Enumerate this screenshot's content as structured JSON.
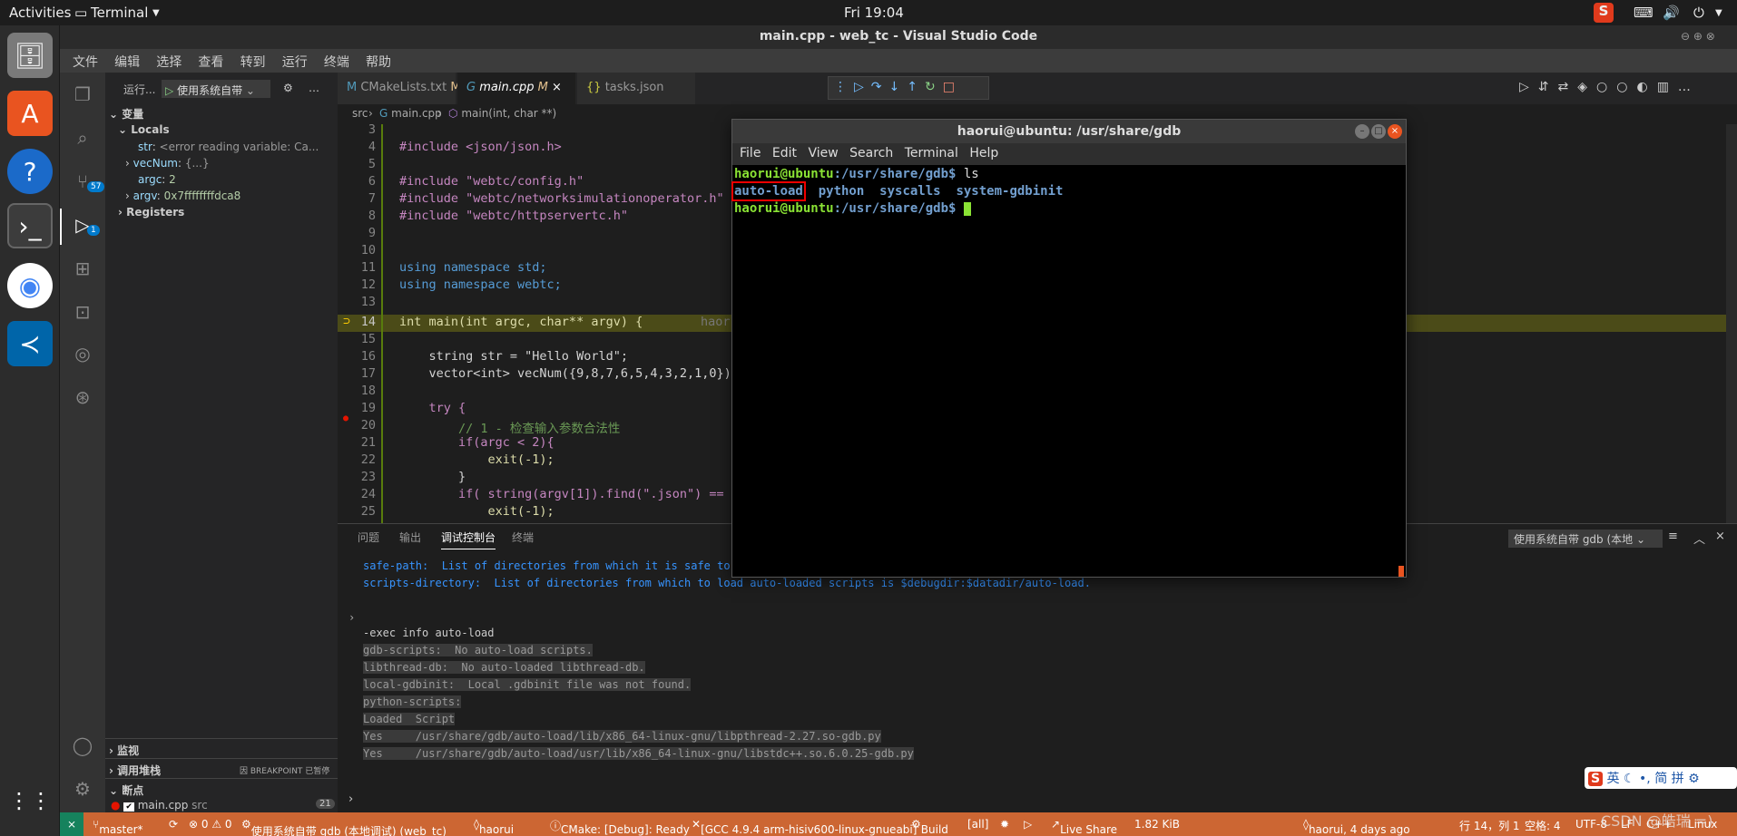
{
  "topbar": {
    "activities": "Activities",
    "app": "Terminal",
    "clock": "Fri 19:04"
  },
  "window": {
    "title": "main.cpp - web_tc - Visual Studio Code"
  },
  "menu": [
    "文件",
    "编辑",
    "选择",
    "查看",
    "转到",
    "运行",
    "终端",
    "帮助"
  ],
  "activity": {
    "source_badge": "57",
    "debug_badge": "1"
  },
  "sidebar": {
    "run_label": "运行...",
    "config": "使用系统自带",
    "variables": "变量",
    "locals": "Locals",
    "vars": [
      {
        "name": "str",
        "value": "<error reading variable: Ca..."
      },
      {
        "name": "vecNum",
        "value": "{...}"
      },
      {
        "name": "argc",
        "value": "2"
      },
      {
        "name": "argv",
        "value": "0x7ffffffffdca8"
      }
    ],
    "registers": "Registers",
    "watch": "监视",
    "callstack": "调用堆栈",
    "breakpoint_status": "因 BREAKPOINT 已暂停",
    "breakpoints": "断点",
    "bp_file": "main.cpp",
    "bp_dir": "src",
    "bp_line": "21"
  },
  "tabs": [
    {
      "label": "CMakeLists.txt",
      "mod": "M"
    },
    {
      "label": "main.cpp",
      "mod": "M"
    },
    {
      "label": "tasks.json",
      "mod": ""
    }
  ],
  "breadcrumb": {
    "folder": "src",
    "file": "main.cpp",
    "symbol": "main(int, char **)"
  },
  "code_lines": [
    "3",
    "4",
    "5",
    "6",
    "7",
    "8",
    "9",
    "10",
    "11",
    "12",
    "13",
    "14",
    "15",
    "16",
    "17",
    "18",
    "19",
    "20",
    "21",
    "22",
    "23",
    "24",
    "25"
  ],
  "code_text": {
    "l4": "#include <json/json.h>",
    "l6": "#include \"webtc/config.h\"",
    "l7": "#include \"webtc/networksimulationoperator.h\"",
    "l8": "#include \"webtc/httpservertc.h\"",
    "l11": "using namespace std;",
    "l12": "using namespace webtc;",
    "l14": "int main(int argc, char** argv) {",
    "l14_hint": "haor",
    "l16": "    string str = \"Hello World\";",
    "l17": "    vector<int> vecNum({9,8,7,6,5,4,3,2,1,0});",
    "l19": "    try {",
    "l20": "        // 1 - 检查输入参数合法性",
    "l21": "        if(argc < 2){",
    "l22": "            exit(-1);",
    "l23": "        }",
    "l24": "        if( string(argv[1]).find(\".json\") ==",
    "l25": "            exit(-1);"
  },
  "panel": {
    "tabs": [
      "问题",
      "输出",
      "调试控制台",
      "终端"
    ],
    "selector": "使用系统自带 gdb (本地",
    "lines": [
      "safe-path:  List of directories from which it is safe to a",
      "scripts-directory:  List of directories from which to load auto-loaded scripts is $debugdir:$datadir/auto-load.",
      "",
      "",
      "-exec info auto-load",
      "gdb-scripts:  No auto-load scripts.",
      "libthread-db:  No auto-loaded libthread-db.",
      "local-gdbinit:  Local .gdbinit file was not found.",
      "python-scripts:",
      "Loaded  Script",
      "Yes     /usr/share/gdb/auto-load/lib/x86_64-linux-gnu/libpthread-2.27.so-gdb.py",
      "Yes     /usr/share/gdb/auto-load/usr/lib/x86_64-linux-gnu/libstdc++.so.6.0.25-gdb.py"
    ]
  },
  "terminal": {
    "title": "haorui@ubuntu: /usr/share/gdb",
    "menu": [
      "File",
      "Edit",
      "View",
      "Search",
      "Terminal",
      "Help"
    ],
    "prompt_user": "haorui@ubuntu",
    "prompt_path": ":/usr/share/gdb$",
    "cmd": " ls",
    "entries": [
      "auto-load",
      "python",
      "syscalls",
      "system-gdbinit"
    ]
  },
  "status": {
    "branch": "master*",
    "errors": "⊗ 0 ⚠ 0",
    "debug": "使用系统自带 gdb (本地调试) (web_tc)",
    "user": "haorui",
    "cmake": "CMake: [Debug]: Ready",
    "kit": "[GCC 4.9.4 arm-hisiv600-linux-gnueabi]",
    "build": "Build",
    "all": "[all]",
    "liveshare": "Live Share",
    "size": "1.82 KiB",
    "blame": "haorui, 4 days ago",
    "pos": "行 14，列 1",
    "spaces": "空格: 4",
    "enc": "UTF-8",
    "eol": "LF",
    "lang": "C++",
    "os": "Linux"
  },
  "ime": {
    "text": "英"
  },
  "watermark": "CSDN @皓瑞 =)"
}
